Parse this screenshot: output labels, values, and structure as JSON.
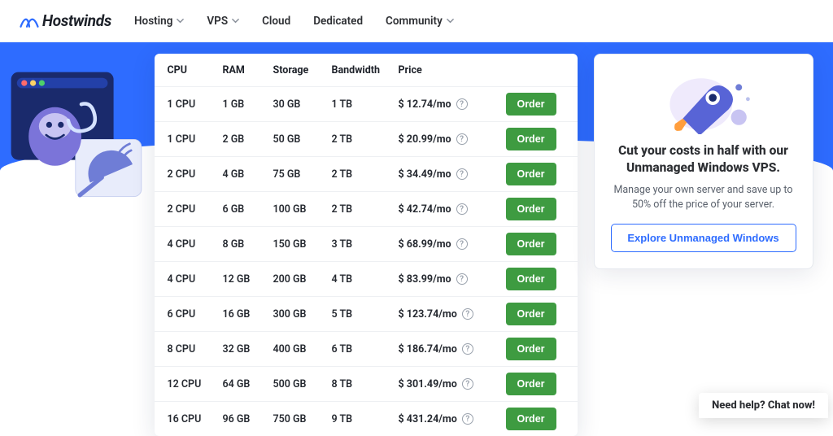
{
  "brand": {
    "name": "Hostwinds"
  },
  "nav": [
    {
      "label": "Hosting",
      "dropdown": true
    },
    {
      "label": "VPS",
      "dropdown": true
    },
    {
      "label": "Cloud",
      "dropdown": false
    },
    {
      "label": "Dedicated",
      "dropdown": false
    },
    {
      "label": "Community",
      "dropdown": true
    }
  ],
  "pricing": {
    "columns": [
      "CPU",
      "RAM",
      "Storage",
      "Bandwidth",
      "Price"
    ],
    "order_label": "Order",
    "rows": [
      {
        "cpu": "1 CPU",
        "ram": "1 GB",
        "storage": "30 GB",
        "bandwidth": "1 TB",
        "price": "$ 12.74/mo"
      },
      {
        "cpu": "1 CPU",
        "ram": "2 GB",
        "storage": "50 GB",
        "bandwidth": "2 TB",
        "price": "$ 20.99/mo"
      },
      {
        "cpu": "2 CPU",
        "ram": "4 GB",
        "storage": "75 GB",
        "bandwidth": "2 TB",
        "price": "$ 34.49/mo"
      },
      {
        "cpu": "2 CPU",
        "ram": "6 GB",
        "storage": "100 GB",
        "bandwidth": "2 TB",
        "price": "$ 42.74/mo"
      },
      {
        "cpu": "4 CPU",
        "ram": "8 GB",
        "storage": "150 GB",
        "bandwidth": "3 TB",
        "price": "$ 68.99/mo"
      },
      {
        "cpu": "4 CPU",
        "ram": "12 GB",
        "storage": "200 GB",
        "bandwidth": "4 TB",
        "price": "$ 83.99/mo"
      },
      {
        "cpu": "6 CPU",
        "ram": "16 GB",
        "storage": "300 GB",
        "bandwidth": "5 TB",
        "price": "$ 123.74/mo"
      },
      {
        "cpu": "8 CPU",
        "ram": "32 GB",
        "storage": "400 GB",
        "bandwidth": "6 TB",
        "price": "$ 186.74/mo"
      },
      {
        "cpu": "12 CPU",
        "ram": "64 GB",
        "storage": "500 GB",
        "bandwidth": "8 TB",
        "price": "$ 301.49/mo"
      },
      {
        "cpu": "16 CPU",
        "ram": "96 GB",
        "storage": "750 GB",
        "bandwidth": "9 TB",
        "price": "$ 431.24/mo"
      }
    ]
  },
  "promo": {
    "title": "Cut your costs in half with our Unmanaged Windows VPS.",
    "subtitle": "Manage your own server and save up to 50% off the price of your server.",
    "cta": "Explore Unmanaged Windows"
  },
  "chat": {
    "label": "Need help? Chat now!"
  },
  "colors": {
    "primary": "#2e6cff",
    "order_green": "#3e9b41"
  }
}
